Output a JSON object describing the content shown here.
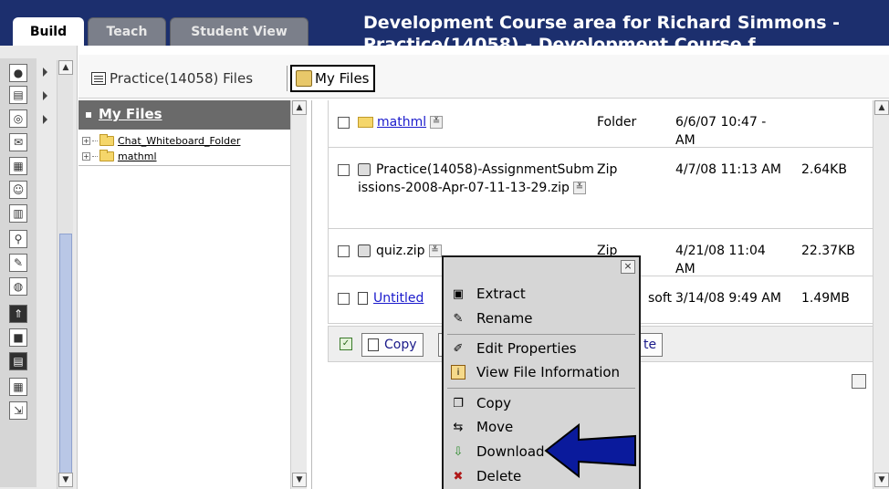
{
  "header": {
    "tabs": [
      "Build",
      "Teach",
      "Student View"
    ],
    "course_title_line1": "Development Course area for Richard Simmons -",
    "course_title_line2": "Practice(14058) - Development Course f"
  },
  "toolbar": {
    "practice_files": "Practice(14058) Files",
    "my_files": "My Files"
  },
  "tree": {
    "title": "My Files",
    "items": [
      "Chat_Whiteboard_Folder",
      "mathml"
    ]
  },
  "files": [
    {
      "name": "mathml",
      "type": "Folder",
      "date": "6/6/07 10:47 - AM",
      "size": "",
      "icon": "folder-icon",
      "link": true
    },
    {
      "name": "Practice(14058)-AssignmentSubmissions-2008-Apr-07-11-13-29.zip",
      "type": "Zip",
      "date": "4/7/08 11:13 AM",
      "size": "2.64KB",
      "icon": "zip-icon",
      "link": false
    },
    {
      "name": "quiz.zip",
      "type": "Zip",
      "date": "4/21/08 11:04 AM",
      "size": "22.37KB",
      "icon": "zip-icon",
      "link": false
    },
    {
      "name": "Untitled",
      "type": "soft",
      "date": "3/14/08 9:49 AM",
      "size": "1.49MB",
      "icon": "document-icon",
      "link": true
    }
  ],
  "action_bar": {
    "copy": "Copy",
    "tail": "te"
  },
  "context_menu": {
    "close": "×",
    "items": [
      "Extract",
      "Rename",
      "Edit Properties",
      "View File Information",
      "Copy",
      "Move",
      "Download",
      "Delete"
    ]
  },
  "colors": {
    "header_bg": "#1c2f6e",
    "arrow_fill": "#0a1a9c",
    "link": "#1a1acc"
  }
}
